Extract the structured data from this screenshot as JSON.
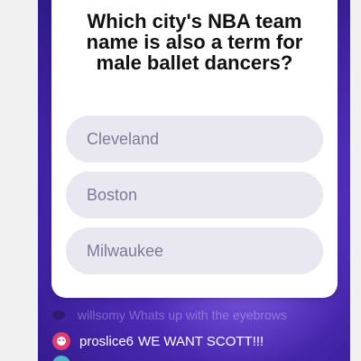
{
  "question": {
    "text": "Which city's NBA team name is also a term for male ballet dancers?"
  },
  "answers": [
    {
      "label": "Cleveland"
    },
    {
      "label": "Boston"
    },
    {
      "label": "Milwaukee"
    }
  ],
  "chat": {
    "faded_line": {
      "username": "willsomy",
      "message": "Whats up with the eyebrows"
    },
    "line": {
      "username": "proslice6",
      "message": "WE WANT SCOTT!!!",
      "avatar_icon": "smiley-face-icon"
    }
  },
  "colors": {
    "background_purple": "#4f2dbb",
    "answer_bg": "#e9e8f0",
    "answer_text": "#7d7a98",
    "avatar_pink": "#e23d6e",
    "avatar_teal": "#4cb6c9"
  }
}
